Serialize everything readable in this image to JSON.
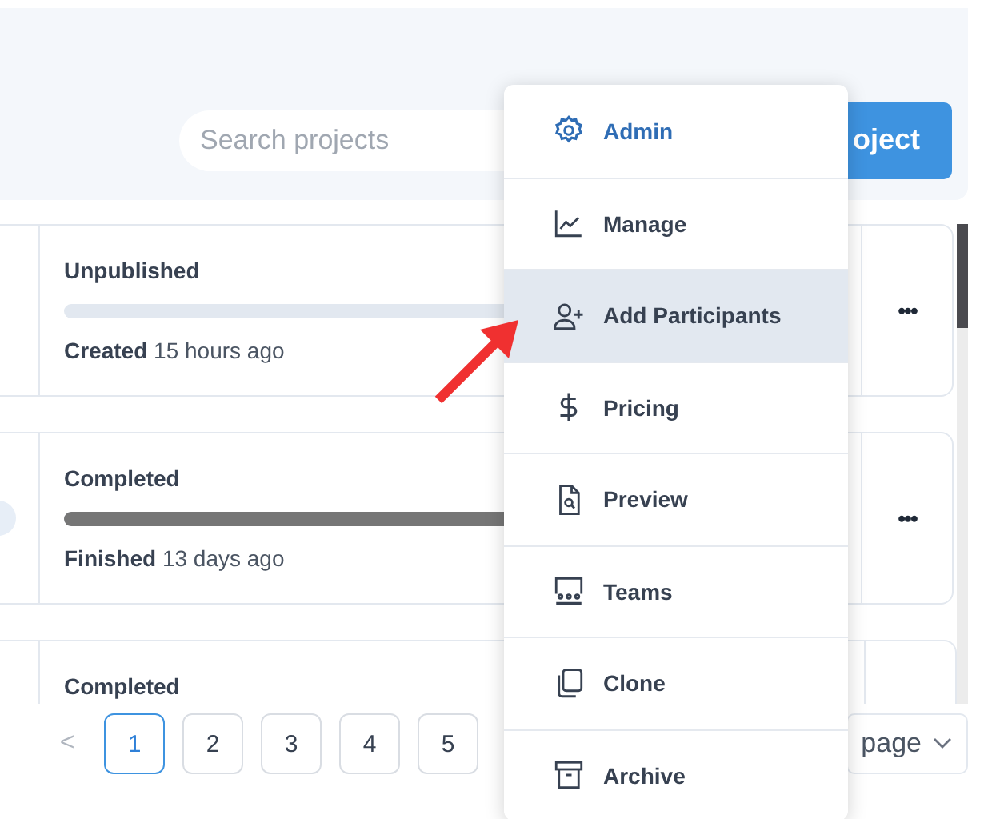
{
  "header": {
    "search": {
      "placeholder": "Search projects"
    },
    "new_button": "oject"
  },
  "projects": [
    {
      "status": "Unpublished",
      "level": 0,
      "date_label": "Created",
      "date": "15 hours ago",
      "menu_icon": "•••",
      "avatar": false
    },
    {
      "status": "Completed",
      "level": 1,
      "date_label": "Finished",
      "date": "13 days ago",
      "menu_icon": "•••",
      "avatar": true
    },
    {
      "status": "Completed",
      "avatar": false
    }
  ],
  "pagination": {
    "prev": "<",
    "pages": [
      {
        "label": "1",
        "selected": true
      },
      {
        "label": "2",
        "selected": false
      },
      {
        "label": "3",
        "selected": false
      },
      {
        "label": "4",
        "selected": false
      },
      {
        "label": "5",
        "selected": false
      }
    ],
    "per_page": "page"
  },
  "menu": [
    {
      "kind": "gear",
      "label": "Admin",
      "selected": false,
      "accent": true
    },
    {
      "kind": "chart",
      "label": "Manage",
      "selected": false,
      "accent": false
    },
    {
      "kind": "user-plus",
      "label": "Add Participants",
      "selected": true,
      "accent": false
    },
    {
      "kind": "dollar",
      "label": "Pricing",
      "selected": false,
      "accent": false
    },
    {
      "kind": "file-search",
      "label": "Preview",
      "selected": false,
      "accent": false
    },
    {
      "kind": "teams",
      "label": "Teams",
      "selected": false,
      "accent": false
    },
    {
      "kind": "copy",
      "label": "Clone",
      "selected": false,
      "accent": false
    },
    {
      "kind": "archive",
      "label": "Archive",
      "selected": false,
      "accent": false
    }
  ]
}
